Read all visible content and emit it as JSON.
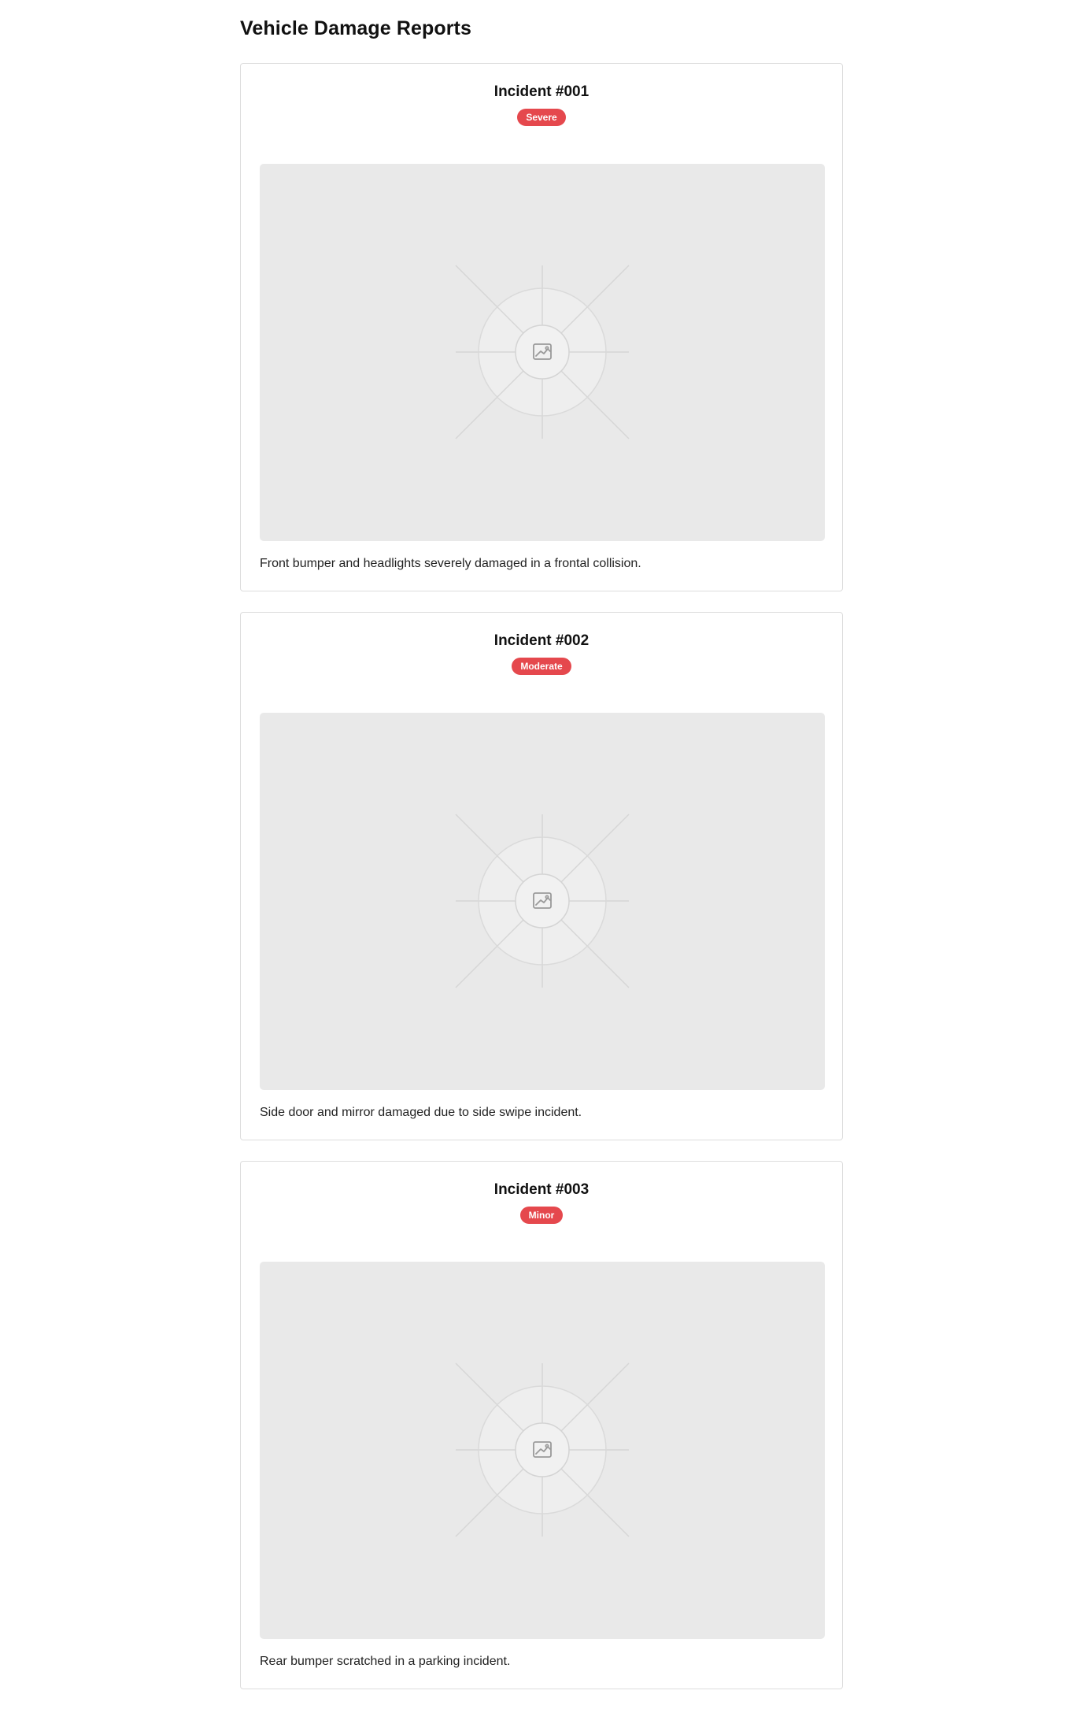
{
  "page": {
    "title": "Vehicle Damage Reports"
  },
  "colors": {
    "badge": "#e5484d",
    "placeholder_bg": "#e9e9e9"
  },
  "incidents": [
    {
      "title": "Incident #001",
      "severity": "Severe",
      "image_icon": "image-icon",
      "description": "Front bumper and headlights severely damaged in a frontal collision."
    },
    {
      "title": "Incident #002",
      "severity": "Moderate",
      "image_icon": "image-icon",
      "description": "Side door and mirror damaged due to side swipe incident."
    },
    {
      "title": "Incident #003",
      "severity": "Minor",
      "image_icon": "image-icon",
      "description": "Rear bumper scratched in a parking incident."
    }
  ]
}
